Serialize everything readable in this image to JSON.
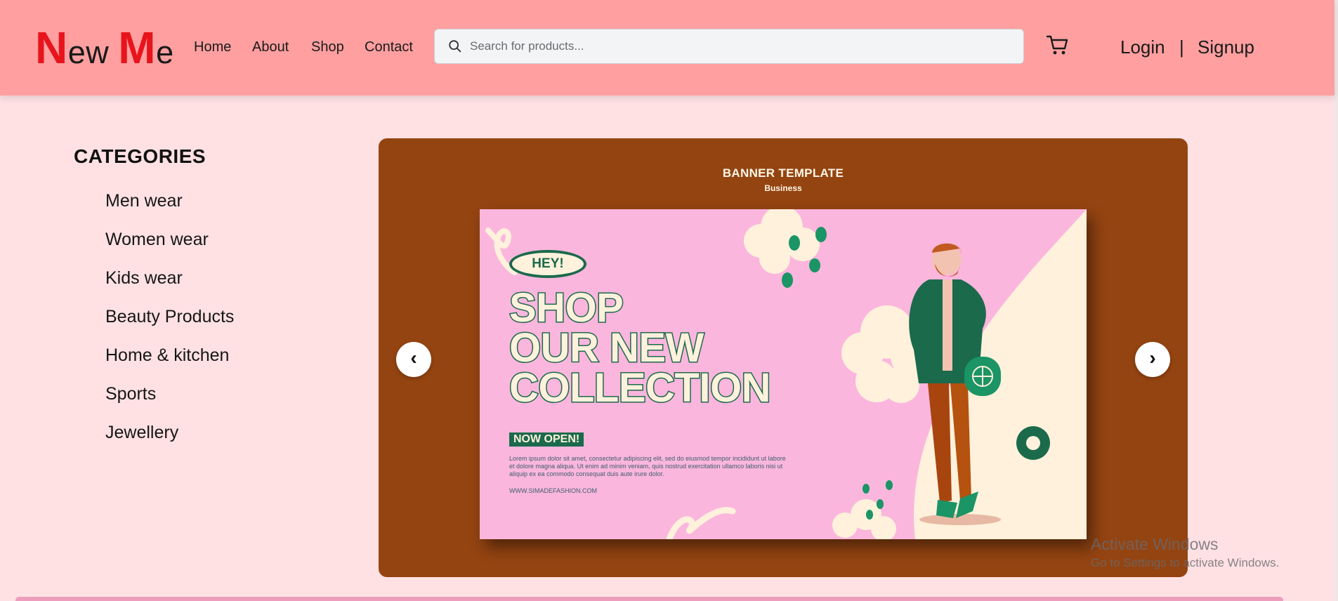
{
  "header": {
    "logo": {
      "big1": "N",
      "small1": "ew ",
      "big2": "M",
      "small2": "e"
    },
    "nav": [
      "Home",
      "About",
      "Shop",
      "Contact"
    ],
    "search": {
      "placeholder": "Search for products..."
    },
    "auth": {
      "login": "Login",
      "separator": "|",
      "signup": "Signup"
    },
    "icons": {
      "search": "search-icon",
      "cart": "cart-icon"
    }
  },
  "categories": {
    "title": "CATEGORIES",
    "items": [
      "Men wear",
      "Women wear",
      "Kids wear",
      "Beauty Products",
      "Home & kitchen",
      "Sports",
      "Jewellery"
    ]
  },
  "banner": {
    "title": "BANNER TEMPLATE",
    "subtitle": "Business",
    "badge": "HEY!",
    "headline": [
      "SHOP",
      "OUR NEW",
      "COLLECTION"
    ],
    "tag": "NOW OPEN!",
    "body": "Lorem ipsum dolor sit amet, consectetur adipiscing elit, sed do eiusmod tempor incididunt ut labore et dolore magna aliqua. Ut enim ad minim veniam, quis nostrud exercitation ullamco laboris nisi ut aliquip ex ea commodo consequat duis aute irure dolor.",
    "url": "WWW.SIMADEFASHION.COM",
    "prev": "‹",
    "next": "›"
  },
  "watermark": {
    "line1": "Activate Windows",
    "line2": "Go to Settings to activate Windows."
  },
  "colors": {
    "header_bg": "#ff9fa0",
    "page_bg": "#ffe1e4",
    "logo_accent": "#e8141c",
    "banner_bg": "#944411",
    "poster_bg": "#fbb6dd",
    "poster_green": "#1b6a4c",
    "poster_cream": "#fff1dc",
    "bottom_bar": "#ee9dbd"
  }
}
